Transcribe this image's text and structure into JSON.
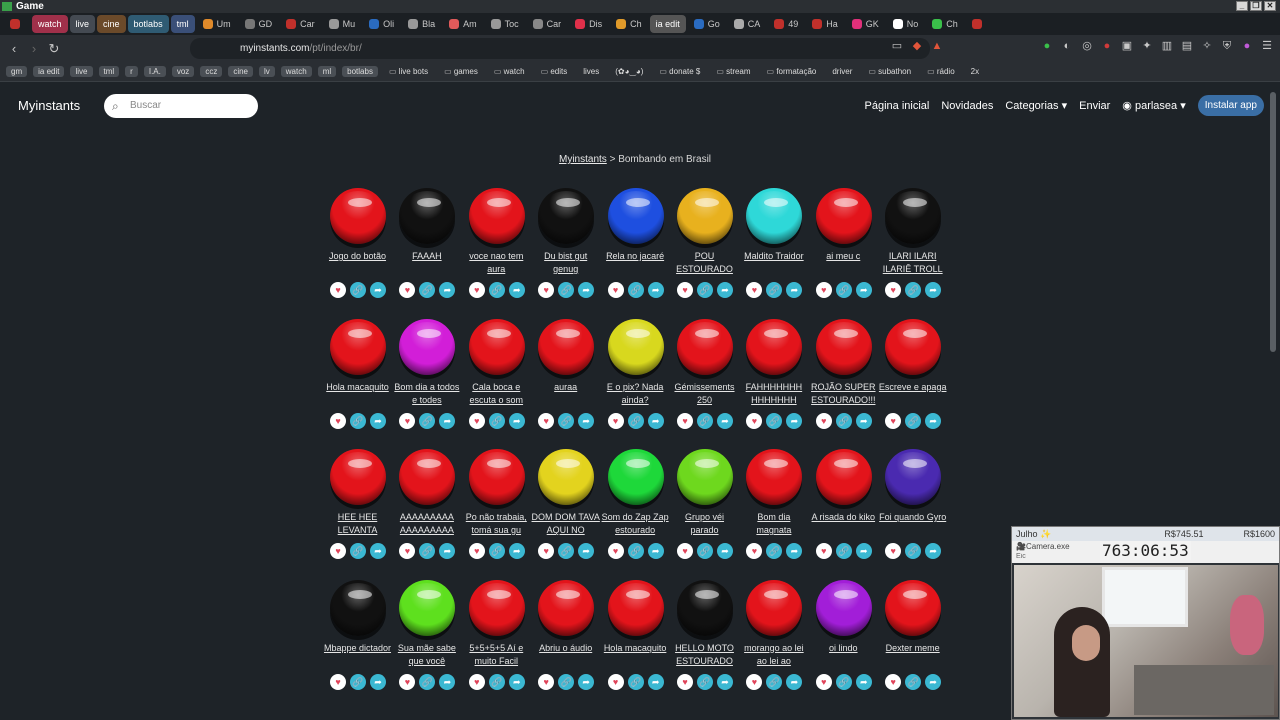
{
  "os": {
    "title": "Game"
  },
  "tabs": [
    {
      "label": "",
      "color": "#c0302b"
    },
    {
      "label": "watch",
      "color": "#a0304a",
      "group": true
    },
    {
      "label": "live",
      "color": "#444a52",
      "group": true
    },
    {
      "label": "cine",
      "color": "#6b4a2a",
      "group": true
    },
    {
      "label": "botlabs",
      "color": "#2f5b73",
      "group": true
    },
    {
      "label": "tml",
      "color": "#3a4f78",
      "group": true
    },
    {
      "label": "Um",
      "color": "#e08a2a"
    },
    {
      "label": "GD",
      "color": "#777"
    },
    {
      "label": "Car",
      "color": "#c0302b"
    },
    {
      "label": "Mu",
      "color": "#999"
    },
    {
      "label": "Oli",
      "color": "#2a6bc0"
    },
    {
      "label": "Bla",
      "color": "#999"
    },
    {
      "label": "Am",
      "color": "#e05a5a"
    },
    {
      "label": "Toc",
      "color": "#999"
    },
    {
      "label": "Car",
      "color": "#888"
    },
    {
      "label": "Dis",
      "color": "#e0304a"
    },
    {
      "label": "Ch",
      "color": "#e09a2a"
    },
    {
      "label": "ia edit",
      "color": "#555",
      "group": true,
      "active": true
    },
    {
      "label": "Go",
      "color": "#2a6bc0"
    },
    {
      "label": "CA",
      "color": "#aaa"
    },
    {
      "label": "49",
      "color": "#c0302b"
    },
    {
      "label": "Ha",
      "color": "#c0302b"
    },
    {
      "label": "GK",
      "color": "#e0307a"
    },
    {
      "label": "No",
      "color": "#fff"
    },
    {
      "label": "Ch",
      "color": "#3ac04a"
    },
    {
      "label": "",
      "color": "#c0302b"
    }
  ],
  "url": {
    "host": "myinstants.com",
    "path": "/pt/index/br/"
  },
  "bookmarks": [
    {
      "label": "gm",
      "pill": true
    },
    {
      "label": "ia edit",
      "pill": true
    },
    {
      "label": "live",
      "pill": true
    },
    {
      "label": "tml",
      "pill": true
    },
    {
      "label": "r",
      "pill": true
    },
    {
      "label": "I.A.",
      "pill": true
    },
    {
      "label": "voz",
      "pill": true
    },
    {
      "label": "ccz",
      "pill": true
    },
    {
      "label": "cine",
      "pill": true
    },
    {
      "label": "lv",
      "pill": true
    },
    {
      "label": "watch",
      "pill": true
    },
    {
      "label": "ml",
      "pill": true
    },
    {
      "label": "botlabs",
      "pill": true
    },
    {
      "label": "live bots",
      "folder": true
    },
    {
      "label": "games",
      "folder": true
    },
    {
      "label": "watch",
      "folder": true
    },
    {
      "label": "edits",
      "folder": true
    },
    {
      "label": "lives"
    },
    {
      "label": "(✿◕‿◕)"
    },
    {
      "label": "donate $",
      "folder": true
    },
    {
      "label": "stream",
      "folder": true
    },
    {
      "label": "formatação",
      "folder": true
    },
    {
      "label": "driver"
    },
    {
      "label": "subathon",
      "folder": true
    },
    {
      "label": "rádio",
      "folder": true
    },
    {
      "label": "2x"
    }
  ],
  "header": {
    "logo": "Myinstants",
    "search_placeholder": "Buscar",
    "nav": [
      "Página inicial",
      "Novidades",
      "Categorias ▾",
      "Enviar"
    ],
    "user": "parlasea ▾",
    "install": "Instalar app"
  },
  "breadcrumb": {
    "home": "Myinstants",
    "sep": ">",
    "current": "Bombando em Brasil"
  },
  "buttons": [
    {
      "label": "Jogo do botão",
      "color": "#e3141b"
    },
    {
      "label": "FAAAH",
      "color": "#111111"
    },
    {
      "label": "voce nao tem aura",
      "color": "#e3141b"
    },
    {
      "label": "Du bist gut genug",
      "color": "#111111"
    },
    {
      "label": "Rela no jacaré",
      "color": "#1e4fe0"
    },
    {
      "label": "POU ESTOURADO",
      "color": "#e8b11e"
    },
    {
      "label": "Maldito Traidor",
      "color": "#2ed8d8"
    },
    {
      "label": "ai meu c",
      "color": "#e3141b"
    },
    {
      "label": "ILARI ILARI ILARIÊ TROLL",
      "color": "#111111"
    },
    {
      "label": "Hola macaquito",
      "color": "#e3141b"
    },
    {
      "label": "Bom dia a todos e todes",
      "color": "#d21ed8"
    },
    {
      "label": "Cala boca e escuta o som",
      "color": "#e3141b"
    },
    {
      "label": "auraa",
      "color": "#e3141b"
    },
    {
      "label": "E o pix? Nada ainda?",
      "color": "#d8d81e"
    },
    {
      "label": "Gémissements 250",
      "color": "#e3141b"
    },
    {
      "label": "FAHHHHHHH HHHHHHH",
      "color": "#e3141b"
    },
    {
      "label": "ROJÃO SUPER ESTOURADO!!!",
      "color": "#e3141b"
    },
    {
      "label": "Escreve e apaga",
      "color": "#e3141b"
    },
    {
      "label": "HEE HEE LEVANTA",
      "color": "#e3141b"
    },
    {
      "label": "AAAAAAAAA AAAAAAAAA",
      "color": "#e3141b"
    },
    {
      "label": "Po não trabaia, tomá sua gu",
      "color": "#e3141b"
    },
    {
      "label": "DOM DOM TAVA AQUI NO",
      "color": "#e3d31e"
    },
    {
      "label": "Som do Zap Zap estourado",
      "color": "#1ed83a"
    },
    {
      "label": "Grupo véi parado",
      "color": "#6ed81e"
    },
    {
      "label": "Bom dia magnata",
      "color": "#e3141b"
    },
    {
      "label": "A risada do kiko",
      "color": "#e3141b"
    },
    {
      "label": "Foi quando Gyro",
      "color": "#4a2ab0"
    },
    {
      "label": "Mbappe dictador",
      "color": "#111111"
    },
    {
      "label": "Sua mãe sabe que você",
      "color": "#5ee01e"
    },
    {
      "label": "5+5+5+5 Aí e muito Facil",
      "color": "#e3141b"
    },
    {
      "label": "Abriu o áudio",
      "color": "#e3141b"
    },
    {
      "label": "Hola macaquito",
      "color": "#e3141b"
    },
    {
      "label": "HELLO MOTO ESTOURADO",
      "color": "#111111"
    },
    {
      "label": "morango ao lei ao lei ao",
      "color": "#e3141b"
    },
    {
      "label": "oi lindo",
      "color": "#a21ed8"
    },
    {
      "label": "Dexter meme",
      "color": "#e3141b"
    }
  ],
  "overlay": {
    "name": "Julho ✨",
    "amount_left": "R$745.51",
    "amount_right": "R$1600",
    "app": "🎥Camera.exe",
    "timer": "763:06:53",
    "sub": "Eic"
  }
}
